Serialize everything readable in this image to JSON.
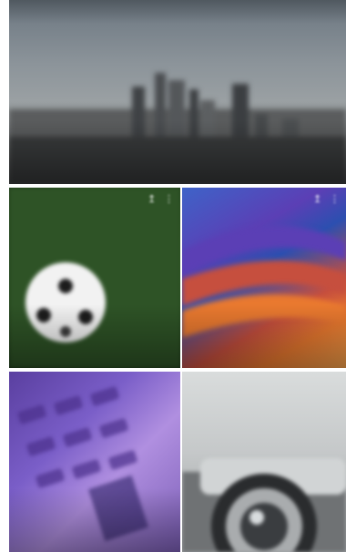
{
  "feed": {
    "hero": {
      "source": "",
      "title": "",
      "subtitle": "",
      "image": "city-skyline"
    },
    "tiles": [
      {
        "id": "sports",
        "label": "",
        "caption_title": "",
        "caption_text": "",
        "image": "soccer-ball"
      },
      {
        "id": "abstract",
        "label": "",
        "caption_title": "",
        "caption_text": "",
        "image": "colorful-abstract"
      },
      {
        "id": "tech",
        "label": "",
        "caption_title": "",
        "caption_text": "",
        "image": "purple-keyboard"
      },
      {
        "id": "camera",
        "label": "",
        "caption_title": "",
        "caption_text": "",
        "image": "camera-lens"
      }
    ]
  },
  "colors": {
    "background": "#ffffff",
    "grass": "#2e5326",
    "accent_orange": "#e9792f",
    "accent_blue": "#3e63c8",
    "accent_purple": "#7a5ec8"
  }
}
